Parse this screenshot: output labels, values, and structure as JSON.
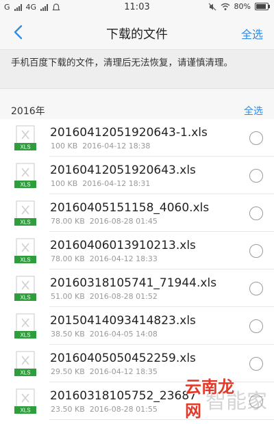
{
  "status_bar": {
    "carrier1": "G",
    "carrier2": "4G",
    "time": "11:03",
    "battery": "80%"
  },
  "header": {
    "title": "下载的文件",
    "select_all": "全选"
  },
  "notice": "手机百度下载的文件，清理后无法恢复，请谨慎清理。",
  "section": {
    "year": "2016年",
    "select_all": "全选"
  },
  "colors": {
    "accent": "#2f8be6",
    "xls_badge": "#2e9e3d"
  },
  "file_icon_label": "XLS",
  "files": [
    {
      "name": "20160412051920643-1.xls",
      "size": "100 KB",
      "date": "2016-04-12 18:38"
    },
    {
      "name": "20160412051920643.xls",
      "size": "100 KB",
      "date": "2016-04-12 18:31"
    },
    {
      "name": "20160405151158_4060.xls",
      "size": "78.00 KB",
      "date": "2016-08-28 01:45"
    },
    {
      "name": "20160406013910213.xls",
      "size": "78.00 KB",
      "date": "2016-04-12 18:33"
    },
    {
      "name": "20160318105741_71944.xls",
      "size": "51.00 KB",
      "date": "2016-08-28 01:52"
    },
    {
      "name": "20150414093414823.xls",
      "size": "38.50 KB",
      "date": "2016-04-05 14:08"
    },
    {
      "name": "20160405050452259.xls",
      "size": "29.50 KB",
      "date": "2016-04-12 18:35"
    },
    {
      "name": "20160318105752_23687",
      "size": "23.50 KB",
      "date": "2016-08-28 01:55"
    }
  ],
  "watermark": {
    "text1": "智能家",
    "text2": "云南龙网"
  }
}
